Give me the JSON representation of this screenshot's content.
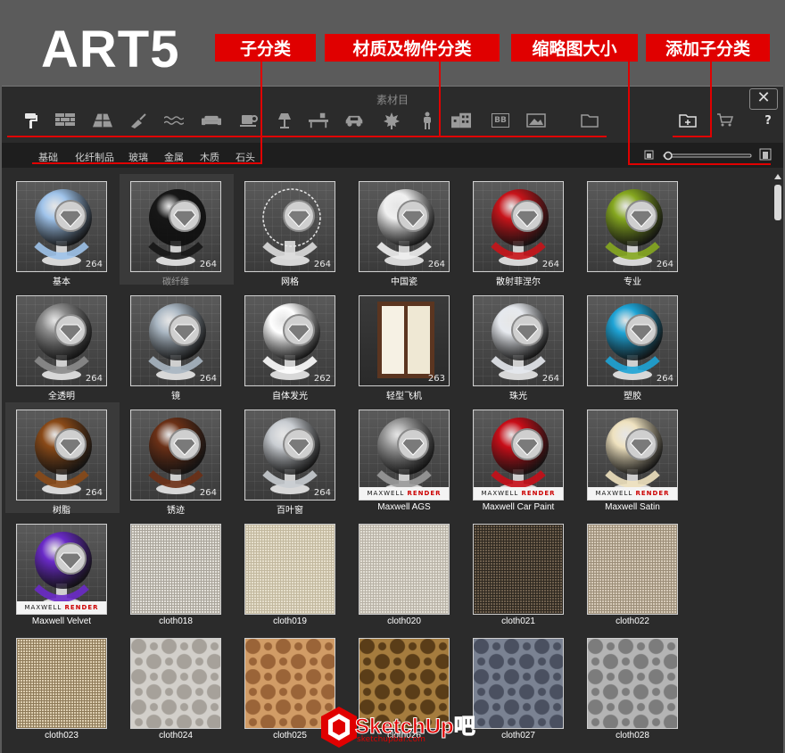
{
  "brand": "ART5",
  "callouts": [
    "子分类",
    "材质及物件分类",
    "缩略图大小",
    "添加子分类"
  ],
  "window": {
    "title": "素材目",
    "close_glyph": "✕"
  },
  "toolbar": {
    "icons": [
      "paint-roller-icon",
      "brick-wall-icon",
      "roof-tiles-icon",
      "trowel-icon",
      "water-icon",
      "sofa-icon",
      "coffee-cup-icon",
      "lamp-icon",
      "desk-icon",
      "car-icon",
      "maple-leaf-icon",
      "person-icon",
      "building-icon",
      "bb-icon",
      "picture-icon",
      "folder-icon"
    ],
    "bb_text": "BB",
    "right_icons": [
      "add-folder-icon",
      "cart-icon",
      "help-icon"
    ],
    "help_text": "?"
  },
  "subcategories": [
    "基础",
    "化纤制品",
    "玻璃",
    "金属",
    "木质",
    "石头"
  ],
  "thumb_number": "264",
  "materials": [
    {
      "label": "基本",
      "type": "sphere",
      "color": "#9fc3ea",
      "num": "264"
    },
    {
      "label": "碳纤维",
      "type": "sphere",
      "color": "#161616",
      "num": "264",
      "selected": true
    },
    {
      "label": "网格",
      "type": "mesh",
      "color": "#e0e0e0",
      "num": "264"
    },
    {
      "label": "中国瓷",
      "type": "sphere",
      "color": "#f0f0f0",
      "num": "264"
    },
    {
      "label": "散射菲涅尔",
      "type": "sphere",
      "color": "#c8141a",
      "num": "264"
    },
    {
      "label": "专业",
      "type": "sphere",
      "color": "#86a820",
      "num": "264"
    },
    {
      "label": "全透明",
      "type": "sphere",
      "color": "#8c8c8c",
      "num": "264"
    },
    {
      "label": "镜",
      "type": "sphere",
      "color": "#a9b6c2",
      "num": "264"
    },
    {
      "label": "自体发光",
      "type": "sphere",
      "color": "#ffffff",
      "num": "262"
    },
    {
      "label": "轻型飞机",
      "type": "door",
      "color": "#5b3520",
      "num": "263"
    },
    {
      "label": "珠光",
      "type": "sphere",
      "color": "#e6e9ee",
      "num": "264"
    },
    {
      "label": "塑胶",
      "type": "sphere",
      "color": "#1ea4d6",
      "num": "264"
    },
    {
      "label": "树脂",
      "type": "sphere",
      "color": "#8a4a18",
      "num": "264",
      "selected": true
    },
    {
      "label": "锈迹",
      "type": "sphere",
      "color": "#6b3016",
      "num": "264"
    },
    {
      "label": "百叶窗",
      "type": "sphere",
      "color": "#c9cdd2",
      "num": "264"
    },
    {
      "label": "Maxwell AGS",
      "type": "maxwell",
      "color": "#9a9a9a"
    },
    {
      "label": "Maxwell Car Paint",
      "type": "maxwell",
      "color": "#c80e18"
    },
    {
      "label": "Maxwell Satin",
      "type": "maxwell",
      "color": "#efe2bf"
    },
    {
      "label": "Maxwell Velvet",
      "type": "maxwell",
      "color": "#6a2ac8"
    },
    {
      "label": "cloth018",
      "type": "cloth",
      "color": "#e2dfd8",
      "color2": "#a9a49a"
    },
    {
      "label": "cloth019",
      "type": "cloth",
      "color": "#e6dfcc",
      "color2": "#c2b89e"
    },
    {
      "label": "cloth020",
      "type": "cloth",
      "color": "#e2ded4",
      "color2": "#b8b2a6"
    },
    {
      "label": "cloth021",
      "type": "cloth",
      "color": "#6d5e4c",
      "color2": "#2e2820"
    },
    {
      "label": "cloth022",
      "type": "cloth",
      "color": "#d6cab8",
      "color2": "#9c8e78"
    },
    {
      "label": "cloth023",
      "type": "cloth",
      "color": "#dccdb0",
      "color2": "#8e7a58"
    },
    {
      "label": "cloth024",
      "type": "damask",
      "color": "#d2cfca",
      "color2": "#a6a19a"
    },
    {
      "label": "cloth025",
      "type": "damask",
      "color": "#d19c66",
      "color2": "#9a6438"
    },
    {
      "label": "cloth026",
      "type": "damask",
      "color": "#a57c3e",
      "color2": "#5a3d18"
    },
    {
      "label": "cloth027",
      "type": "damask",
      "color": "#7a8292",
      "color2": "#4a5060"
    },
    {
      "label": "cloth028",
      "type": "damask",
      "color": "#b4b4b4",
      "color2": "#7c7c7c"
    }
  ],
  "maxwell_text": "MAXWELL",
  "maxwell_text2": "RENDER",
  "logo": {
    "text": "SketchUp吧",
    "url_text": "sketchupbar.com"
  },
  "colors": {
    "accent": "#e00000",
    "panel": "#2b2b2b"
  }
}
